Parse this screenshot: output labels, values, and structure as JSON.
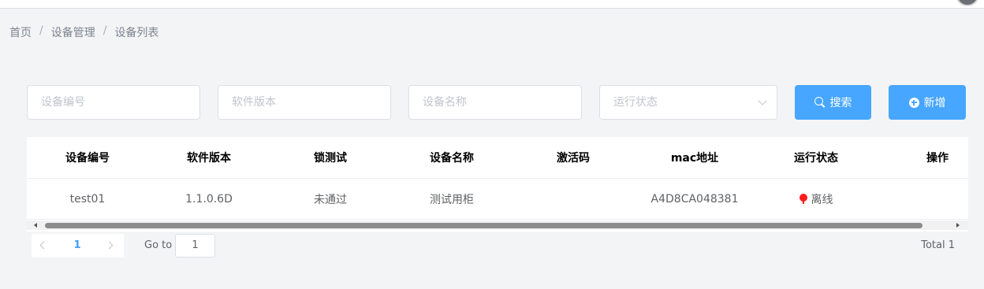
{
  "breadcrumb": [
    "首页",
    "设备管理",
    "设备列表"
  ],
  "breadcrumb_separator": "/",
  "filters": {
    "device_code_placeholder": "设备编号",
    "software_version_placeholder": "软件版本",
    "device_name_placeholder": "设备名称",
    "run_status_placeholder": "运行状态"
  },
  "buttons": {
    "search": "搜索",
    "add": "新增"
  },
  "table": {
    "headers": [
      "设备编号",
      "软件版本",
      "锁测试",
      "设备名称",
      "激活码",
      "mac地址",
      "运行状态",
      "操作"
    ],
    "rows": [
      {
        "device_code": "test01",
        "software_version": "1.1.0.6D",
        "lock_test": "未通过",
        "device_name": "测试用柜",
        "activation_code": "",
        "mac": "A4D8CA048381",
        "status": "离线",
        "actions": ""
      }
    ]
  },
  "pagination": {
    "current_page": "1",
    "goto_label": "Go to",
    "goto_value": "1",
    "total_text": "Total 1"
  },
  "colors": {
    "primary": "#47a6ff",
    "offline": "#e60012",
    "background": "#f3f4f5"
  }
}
